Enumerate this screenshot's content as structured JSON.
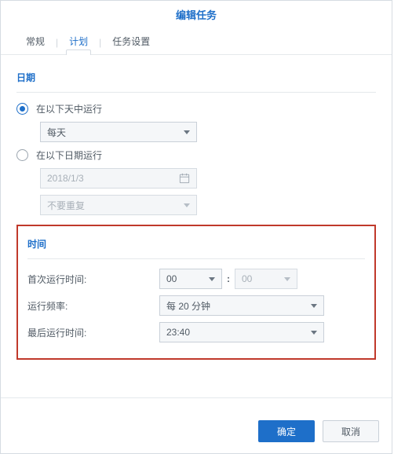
{
  "dialog": {
    "title": "编辑任务"
  },
  "tabs": {
    "general": "常规",
    "schedule": "计划",
    "task_settings": "任务设置",
    "active": "schedule"
  },
  "date_section": {
    "title": "日期",
    "run_on_days": {
      "label": "在以下天中运行",
      "checked": true,
      "frequency": "每天"
    },
    "run_on_date": {
      "label": "在以下日期运行",
      "checked": false,
      "date": "2018/1/3",
      "repeat": "不要重复"
    }
  },
  "time_section": {
    "title": "时间",
    "first_run": {
      "label": "首次运行时间:",
      "hour": "00",
      "minute": "00"
    },
    "frequency": {
      "label": "运行频率:",
      "value": "每 20 分钟"
    },
    "last_run": {
      "label": "最后运行时间:",
      "value": "23:40"
    }
  },
  "buttons": {
    "ok": "确定",
    "cancel": "取消"
  }
}
